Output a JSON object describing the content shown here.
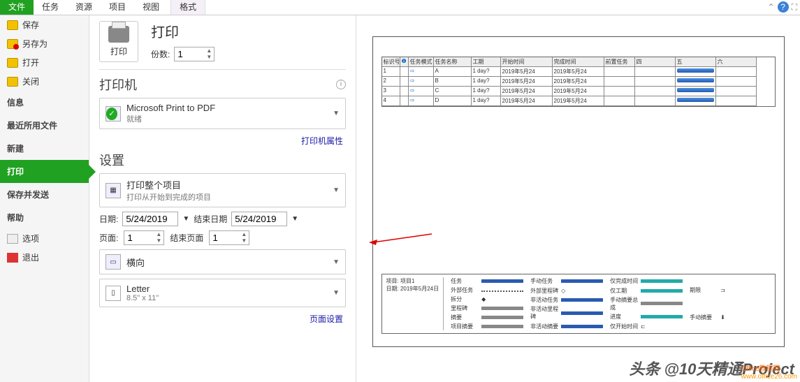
{
  "tabs": {
    "file": "文件",
    "task": "任务",
    "resource": "资源",
    "project": "项目",
    "view": "视图",
    "format": "格式"
  },
  "sidebar": {
    "save": "保存",
    "saveas": "另存为",
    "open": "打开",
    "close": "关闭",
    "info": "信息",
    "recent": "最近所用文件",
    "new": "新建",
    "print": "打印",
    "saveandsend": "保存并发送",
    "help": "帮助",
    "options": "选项",
    "exit": "退出"
  },
  "print": {
    "title": "打印",
    "button": "打印",
    "copies_label": "份数:",
    "copies": "1",
    "printer_head": "打印机",
    "printer_name": "Microsoft Print to PDF",
    "printer_status": "就绪",
    "printer_props": "打印机属性",
    "settings": "设置",
    "scope_title": "打印整个项目",
    "scope_sub": "打印从开始到完成的项目",
    "date_label": "日期:",
    "date_from": "5/24/2019",
    "date_to_label": "结束日期",
    "date_to": "5/24/2019",
    "page_label": "页面:",
    "page_from": "1",
    "page_to_label": "结束页面",
    "page_to": "1",
    "orient": "横向",
    "paper": "Letter",
    "paper_sub": "8.5\" x 11\"",
    "page_setup": "页面设置"
  },
  "preview": {
    "columns": [
      "标识号",
      "",
      "任务模式",
      "任务名称",
      "工期",
      "开始时间",
      "完成时间",
      "前置任务",
      "四",
      "五",
      "六"
    ],
    "rows": [
      {
        "id": "1",
        "name": "A",
        "dur": "1 day?",
        "start": "2019年5月24",
        "end": "2019年5月24"
      },
      {
        "id": "2",
        "name": "B",
        "dur": "1 day?",
        "start": "2019年5月24",
        "end": "2019年5月24"
      },
      {
        "id": "3",
        "name": "C",
        "dur": "1 day?",
        "start": "2019年5月24",
        "end": "2019年5月24"
      },
      {
        "id": "4",
        "name": "D",
        "dur": "1 day?",
        "start": "2019年5月24",
        "end": "2019年5月24"
      }
    ],
    "project_label": "项目: 项目1",
    "project_date": "日期: 2019年5月24日",
    "legend": [
      "任务",
      "外部任务",
      "手动任务",
      "仅完成时间",
      "拆分",
      "外部里程碑",
      "仅工期",
      "期限",
      "里程碑",
      "非活动任务",
      "手动摘要总成",
      "进度",
      "摘要",
      "非活动里程碑",
      "手动摘要",
      "项目摘要",
      "非活动摘要",
      "仅开始时间"
    ]
  },
  "watermark": "头条 @10天精通Project",
  "watermark2": "Office教程网",
  "watermark3": "www.office26.com"
}
